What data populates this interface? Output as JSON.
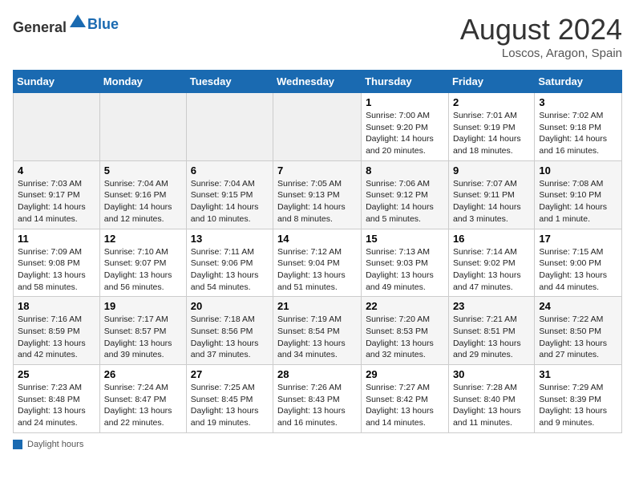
{
  "header": {
    "logo_general": "General",
    "logo_blue": "Blue",
    "month_year": "August 2024",
    "location": "Loscos, Aragon, Spain"
  },
  "days_of_week": [
    "Sunday",
    "Monday",
    "Tuesday",
    "Wednesday",
    "Thursday",
    "Friday",
    "Saturday"
  ],
  "weeks": [
    [
      {
        "day": "",
        "info": ""
      },
      {
        "day": "",
        "info": ""
      },
      {
        "day": "",
        "info": ""
      },
      {
        "day": "",
        "info": ""
      },
      {
        "day": "1",
        "info": "Sunrise: 7:00 AM\nSunset: 9:20 PM\nDaylight: 14 hours and 20 minutes."
      },
      {
        "day": "2",
        "info": "Sunrise: 7:01 AM\nSunset: 9:19 PM\nDaylight: 14 hours and 18 minutes."
      },
      {
        "day": "3",
        "info": "Sunrise: 7:02 AM\nSunset: 9:18 PM\nDaylight: 14 hours and 16 minutes."
      }
    ],
    [
      {
        "day": "4",
        "info": "Sunrise: 7:03 AM\nSunset: 9:17 PM\nDaylight: 14 hours and 14 minutes."
      },
      {
        "day": "5",
        "info": "Sunrise: 7:04 AM\nSunset: 9:16 PM\nDaylight: 14 hours and 12 minutes."
      },
      {
        "day": "6",
        "info": "Sunrise: 7:04 AM\nSunset: 9:15 PM\nDaylight: 14 hours and 10 minutes."
      },
      {
        "day": "7",
        "info": "Sunrise: 7:05 AM\nSunset: 9:13 PM\nDaylight: 14 hours and 8 minutes."
      },
      {
        "day": "8",
        "info": "Sunrise: 7:06 AM\nSunset: 9:12 PM\nDaylight: 14 hours and 5 minutes."
      },
      {
        "day": "9",
        "info": "Sunrise: 7:07 AM\nSunset: 9:11 PM\nDaylight: 14 hours and 3 minutes."
      },
      {
        "day": "10",
        "info": "Sunrise: 7:08 AM\nSunset: 9:10 PM\nDaylight: 14 hours and 1 minute."
      }
    ],
    [
      {
        "day": "11",
        "info": "Sunrise: 7:09 AM\nSunset: 9:08 PM\nDaylight: 13 hours and 58 minutes."
      },
      {
        "day": "12",
        "info": "Sunrise: 7:10 AM\nSunset: 9:07 PM\nDaylight: 13 hours and 56 minutes."
      },
      {
        "day": "13",
        "info": "Sunrise: 7:11 AM\nSunset: 9:06 PM\nDaylight: 13 hours and 54 minutes."
      },
      {
        "day": "14",
        "info": "Sunrise: 7:12 AM\nSunset: 9:04 PM\nDaylight: 13 hours and 51 minutes."
      },
      {
        "day": "15",
        "info": "Sunrise: 7:13 AM\nSunset: 9:03 PM\nDaylight: 13 hours and 49 minutes."
      },
      {
        "day": "16",
        "info": "Sunrise: 7:14 AM\nSunset: 9:02 PM\nDaylight: 13 hours and 47 minutes."
      },
      {
        "day": "17",
        "info": "Sunrise: 7:15 AM\nSunset: 9:00 PM\nDaylight: 13 hours and 44 minutes."
      }
    ],
    [
      {
        "day": "18",
        "info": "Sunrise: 7:16 AM\nSunset: 8:59 PM\nDaylight: 13 hours and 42 minutes."
      },
      {
        "day": "19",
        "info": "Sunrise: 7:17 AM\nSunset: 8:57 PM\nDaylight: 13 hours and 39 minutes."
      },
      {
        "day": "20",
        "info": "Sunrise: 7:18 AM\nSunset: 8:56 PM\nDaylight: 13 hours and 37 minutes."
      },
      {
        "day": "21",
        "info": "Sunrise: 7:19 AM\nSunset: 8:54 PM\nDaylight: 13 hours and 34 minutes."
      },
      {
        "day": "22",
        "info": "Sunrise: 7:20 AM\nSunset: 8:53 PM\nDaylight: 13 hours and 32 minutes."
      },
      {
        "day": "23",
        "info": "Sunrise: 7:21 AM\nSunset: 8:51 PM\nDaylight: 13 hours and 29 minutes."
      },
      {
        "day": "24",
        "info": "Sunrise: 7:22 AM\nSunset: 8:50 PM\nDaylight: 13 hours and 27 minutes."
      }
    ],
    [
      {
        "day": "25",
        "info": "Sunrise: 7:23 AM\nSunset: 8:48 PM\nDaylight: 13 hours and 24 minutes."
      },
      {
        "day": "26",
        "info": "Sunrise: 7:24 AM\nSunset: 8:47 PM\nDaylight: 13 hours and 22 minutes."
      },
      {
        "day": "27",
        "info": "Sunrise: 7:25 AM\nSunset: 8:45 PM\nDaylight: 13 hours and 19 minutes."
      },
      {
        "day": "28",
        "info": "Sunrise: 7:26 AM\nSunset: 8:43 PM\nDaylight: 13 hours and 16 minutes."
      },
      {
        "day": "29",
        "info": "Sunrise: 7:27 AM\nSunset: 8:42 PM\nDaylight: 13 hours and 14 minutes."
      },
      {
        "day": "30",
        "info": "Sunrise: 7:28 AM\nSunset: 8:40 PM\nDaylight: 13 hours and 11 minutes."
      },
      {
        "day": "31",
        "info": "Sunrise: 7:29 AM\nSunset: 8:39 PM\nDaylight: 13 hours and 9 minutes."
      }
    ]
  ],
  "footer": {
    "daylight_label": "Daylight hours"
  }
}
